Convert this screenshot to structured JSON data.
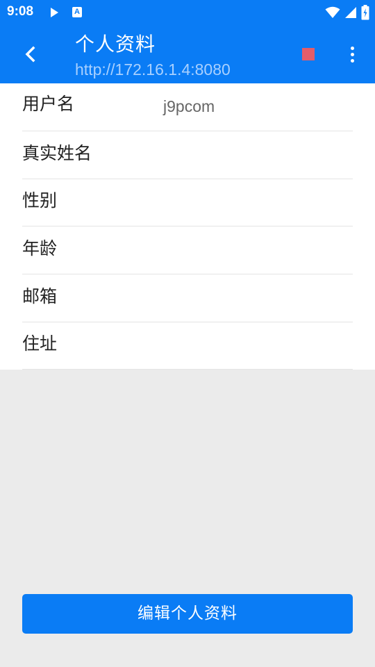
{
  "status_bar": {
    "time": "9:08",
    "a_badge": "A",
    "icons": [
      "play-icon",
      "app-a-icon",
      "wifi-icon",
      "signal-icon",
      "battery-icon"
    ]
  },
  "app_bar": {
    "title": "个人资料",
    "subtitle": "http://172.16.1.4:8080",
    "back_icon": "chevron-left-icon",
    "stop_icon": "stop-square-icon",
    "more_icon": "more-vert-icon"
  },
  "profile": {
    "fields": [
      {
        "label": "用户名",
        "value": "j9pcom"
      },
      {
        "label": "真实姓名",
        "value": ""
      },
      {
        "label": "性别",
        "value": ""
      },
      {
        "label": "年龄",
        "value": ""
      },
      {
        "label": "邮箱",
        "value": ""
      },
      {
        "label": "住址",
        "value": ""
      }
    ]
  },
  "edit_button": {
    "label": "编辑个人资料"
  },
  "colors": {
    "primary": "#0a7cf5",
    "stop": "#e35d6a",
    "subtitle": "#a8d0ff",
    "background": "#ebebeb"
  }
}
